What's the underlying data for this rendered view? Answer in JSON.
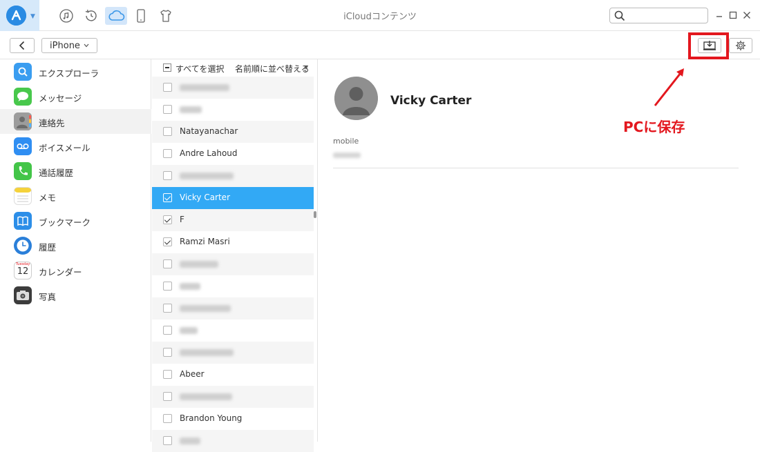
{
  "app": {
    "window_title": "iCloudコンテンツ"
  },
  "topnav": {
    "items": [
      {
        "name": "music-tab",
        "icon": "music-note-icon"
      },
      {
        "name": "history-tab",
        "icon": "history-icon"
      },
      {
        "name": "icloud-tab",
        "icon": "cloud-icon",
        "active": true
      },
      {
        "name": "phone-tab",
        "icon": "phone-icon"
      },
      {
        "name": "tshirt-tab",
        "icon": "tshirt-icon"
      }
    ],
    "search_placeholder": ""
  },
  "toolbar": {
    "device_label": "iPhone",
    "save_button": "PCに保存"
  },
  "sidebar": {
    "items": [
      {
        "label": "エクスプローラ",
        "icon": "explorer-icon",
        "color": "#3a9df0"
      },
      {
        "label": "メッセージ",
        "icon": "messages-icon",
        "color": "#48c84c"
      },
      {
        "label": "連絡先",
        "icon": "contacts-icon",
        "color": "#8a8a8a",
        "active": true
      },
      {
        "label": "ボイスメール",
        "icon": "voicemail-icon",
        "color": "#2f8ef2"
      },
      {
        "label": "通話履歴",
        "icon": "call-history-icon",
        "color": "#43c548"
      },
      {
        "label": "メモ",
        "icon": "notes-icon",
        "color": "#f5d23b"
      },
      {
        "label": "ブックマーク",
        "icon": "bookmarks-icon",
        "color": "#2c8ee8"
      },
      {
        "label": "履歴",
        "icon": "clock-history-icon",
        "color": "#2a7fd9"
      },
      {
        "label": "カレンダー",
        "icon": "calendar-icon",
        "color": "#ffffff"
      },
      {
        "label": "写真",
        "icon": "camera-icon",
        "color": "#3c3c3c"
      }
    ],
    "calendar_day": "12",
    "calendar_weekday": "Tuesday"
  },
  "list": {
    "select_all_label": "すべてを選択",
    "sort_label": "名前順に並べ替える",
    "rows": [
      {
        "name": "",
        "blurred": true,
        "blur_width": 72,
        "checked": false
      },
      {
        "name": "",
        "blurred": true,
        "blur_width": 32,
        "checked": false
      },
      {
        "name": "Natayanachar",
        "blurred": false,
        "checked": false
      },
      {
        "name": "Andre Lahoud",
        "blurred": false,
        "checked": false
      },
      {
        "name": "",
        "blurred": true,
        "blur_width": 78,
        "checked": false
      },
      {
        "name": "Vicky Carter",
        "blurred": false,
        "checked": true,
        "selected": true
      },
      {
        "name": "F",
        "blurred": false,
        "checked": true
      },
      {
        "name": "Ramzi Masri",
        "blurred": false,
        "checked": true
      },
      {
        "name": "",
        "blurred": true,
        "blur_width": 56,
        "checked": false
      },
      {
        "name": "",
        "blurred": true,
        "blur_width": 30,
        "checked": false
      },
      {
        "name": "",
        "blurred": true,
        "blur_width": 74,
        "checked": false
      },
      {
        "name": "",
        "blurred": true,
        "blur_width": 26,
        "checked": false
      },
      {
        "name": "",
        "blurred": true,
        "blur_width": 78,
        "checked": false
      },
      {
        "name": "Abeer",
        "blurred": false,
        "checked": false
      },
      {
        "name": "",
        "blurred": true,
        "blur_width": 76,
        "checked": false
      },
      {
        "name": "Brandon  Young",
        "blurred": false,
        "checked": false
      },
      {
        "name": "",
        "blurred": true,
        "blur_width": 30,
        "checked": false
      }
    ]
  },
  "detail": {
    "contact_name": "Vicky Carter",
    "field_label": "mobile"
  },
  "annotation": {
    "label": "PCに保存",
    "color": "#e3171e"
  }
}
